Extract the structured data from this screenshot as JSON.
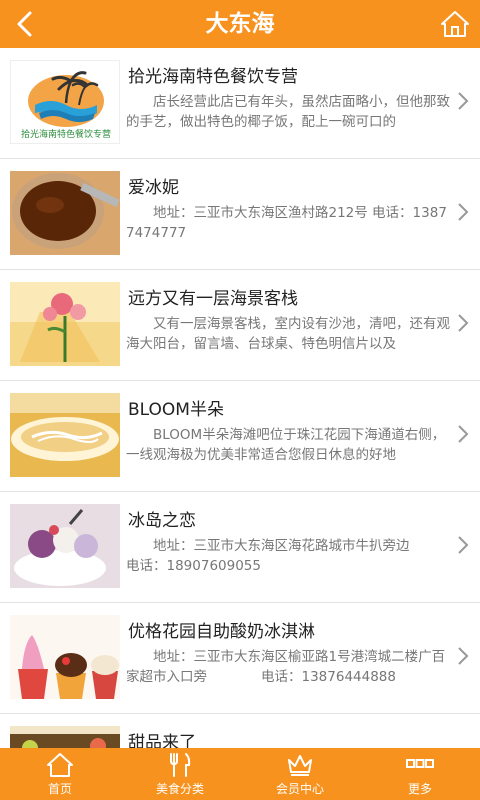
{
  "header": {
    "title": "大东海",
    "back_icon": "back-arrow-icon",
    "home_icon": "home-icon"
  },
  "items": [
    {
      "name": "拾光海南特色餐饮专营",
      "desc": "店长经营此店已有年头，虽然店面略小，但他那致的手艺，做出特色的椰子饭，配上一碗可口的",
      "logo_text": "拾光海南特色餐饮专营"
    },
    {
      "name": "爱冰妮",
      "desc": "地址：三亚市大东海区渔村路212号 电话：13877474777"
    },
    {
      "name": "远方又有一层海景客栈",
      "desc": "又有一层海景客栈，室内设有沙池，清吧，还有观海大阳台，留言墙、台球桌、特色明信片以及"
    },
    {
      "name": "BLOOM半朵",
      "desc": "BLOOM半朵海滩吧位于珠江花园下海通道右侧，一线观海极为优美非常适合您假日休息的好地"
    },
    {
      "name": "冰岛之恋",
      "desc": "地址：三亚市大东海区海花路城市牛扒旁边　　　电话：18907609055"
    },
    {
      "name": "优格花园自助酸奶冰淇淋",
      "desc": "地址：三亚市大东海区榆亚路1号港湾城二楼广百家超市入口旁　　　　电话：13876444888"
    },
    {
      "name": "甜品来了",
      "desc": ""
    }
  ],
  "tabs": [
    {
      "label": "首页",
      "icon": "home-icon"
    },
    {
      "label": "美食分类",
      "icon": "fork-knife-icon"
    },
    {
      "label": "会员中心",
      "icon": "crown-icon"
    },
    {
      "label": "更多",
      "icon": "more-icon"
    }
  ],
  "colors": {
    "accent": "#f7921e",
    "text": "#222222",
    "subtext": "#777777"
  }
}
